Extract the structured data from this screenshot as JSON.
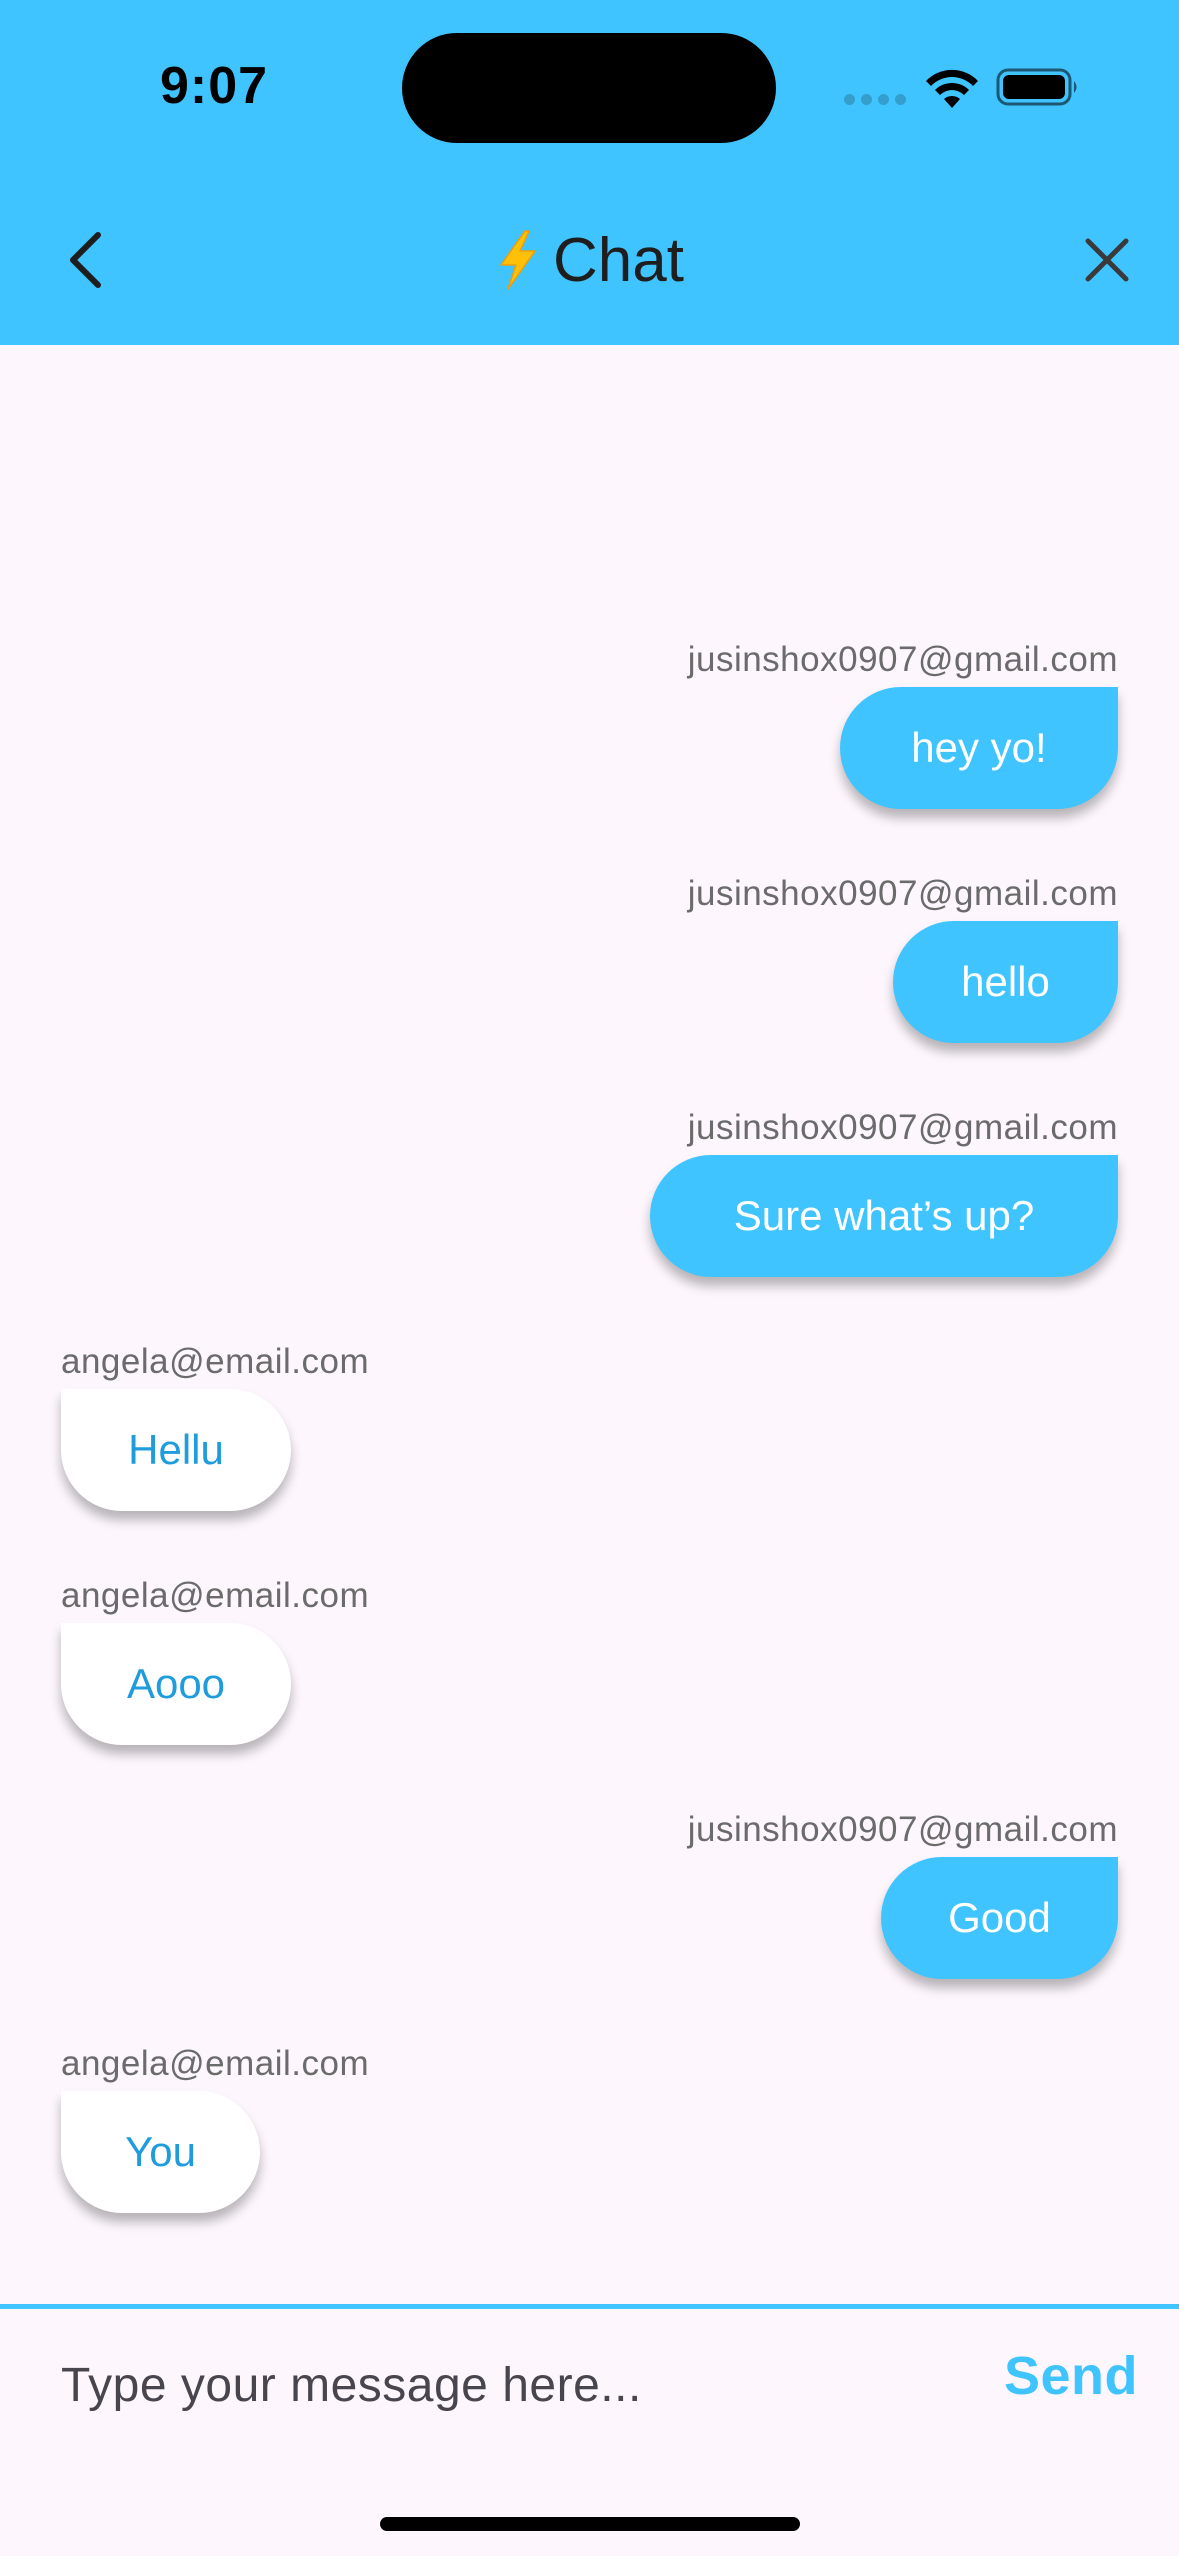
{
  "status_bar": {
    "time": "9:07"
  },
  "header": {
    "title_icon": "lightning-bolt-icon",
    "title": "Chat",
    "back_icon": "chevron-left-icon",
    "close_icon": "close-icon"
  },
  "messages": [
    {
      "sender": "jusinshox0907@gmail.com",
      "text": "hey yo!",
      "is_me": true
    },
    {
      "sender": "jusinshox0907@gmail.com",
      "text": "hello",
      "is_me": true
    },
    {
      "sender": "jusinshox0907@gmail.com",
      "text": "Sure what’s up?",
      "is_me": true
    },
    {
      "sender": "angela@email.com",
      "text": "Hellu",
      "is_me": false
    },
    {
      "sender": "angela@email.com",
      "text": "Aooo",
      "is_me": false
    },
    {
      "sender": "jusinshox0907@gmail.com",
      "text": "Good",
      "is_me": true
    },
    {
      "sender": "angela@email.com",
      "text": "You",
      "is_me": false
    }
  ],
  "composer": {
    "placeholder": "Type your message here...",
    "value": "",
    "send_label": "Send"
  },
  "colors": {
    "accent": "#40c4ff",
    "background": "#fdf7fd",
    "incoming_text": "#1e9cdc"
  }
}
